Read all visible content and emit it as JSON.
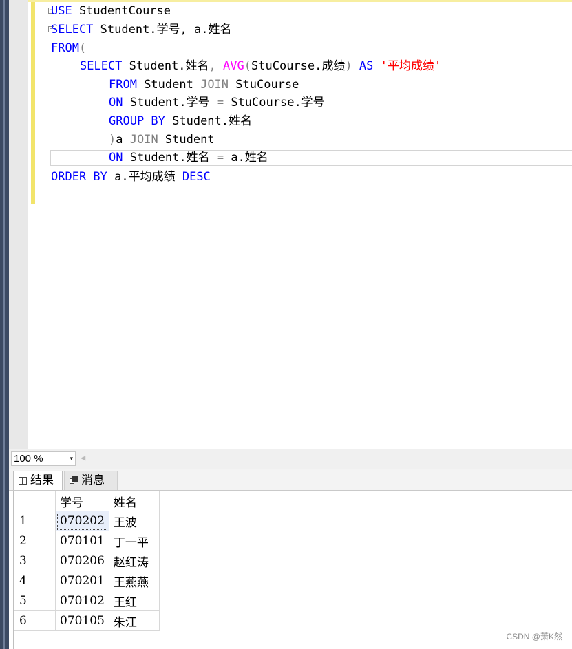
{
  "editor": {
    "lines": [
      [
        {
          "t": "USE",
          "c": "kw"
        },
        {
          "t": " StudentCourse",
          "c": "tx"
        }
      ],
      [
        {
          "t": "SELECT",
          "c": "kw"
        },
        {
          "t": " Student.学号, a.姓名",
          "c": "tx"
        }
      ],
      [
        {
          "t": "FROM",
          "c": "kw"
        },
        {
          "t": "(",
          "c": "gr"
        }
      ],
      [
        {
          "t": "SELECT",
          "c": "kw"
        },
        {
          "t": " Student.姓名",
          "c": "tx"
        },
        {
          "t": ",",
          "c": "gr"
        },
        {
          "t": " ",
          "c": "tx"
        },
        {
          "t": "AVG",
          "c": "fn"
        },
        {
          "t": "(",
          "c": "gr"
        },
        {
          "t": "StuCourse.成绩",
          "c": "tx"
        },
        {
          "t": ")",
          "c": "gr"
        },
        {
          "t": " AS",
          "c": "kw"
        },
        {
          "t": " '平均成绩'",
          "c": "str"
        }
      ],
      [
        {
          "t": "FROM",
          "c": "kw"
        },
        {
          "t": " Student ",
          "c": "tx"
        },
        {
          "t": "JOIN",
          "c": "gr"
        },
        {
          "t": " StuCourse",
          "c": "tx"
        }
      ],
      [
        {
          "t": "ON",
          "c": "kw"
        },
        {
          "t": " Student.学号 ",
          "c": "tx"
        },
        {
          "t": "=",
          "c": "gr"
        },
        {
          "t": " StuCourse.学号",
          "c": "tx"
        }
      ],
      [
        {
          "t": "GROUP BY",
          "c": "kw"
        },
        {
          "t": " Student.姓名",
          "c": "tx"
        }
      ],
      [
        {
          "t": ")",
          "c": "gr"
        },
        {
          "t": "a ",
          "c": "tx"
        },
        {
          "t": "JOIN",
          "c": "gr"
        },
        {
          "t": " Student",
          "c": "tx"
        }
      ],
      [
        {
          "t": "ON",
          "c": "kw"
        },
        {
          "t": " Student.姓名 ",
          "c": "tx"
        },
        {
          "t": "=",
          "c": "gr"
        },
        {
          "t": " a.姓名",
          "c": "tx"
        }
      ],
      [
        {
          "t": "ORDER BY",
          "c": "kw"
        },
        {
          "t": " a.平均成绩 ",
          "c": "tx"
        },
        {
          "t": "DESC",
          "c": "kw"
        }
      ]
    ]
  },
  "zoom": {
    "value": "100 %",
    "arrow": "▾"
  },
  "tabs": {
    "results": "结果",
    "messages": "消息"
  },
  "grid": {
    "columns": [
      "学号",
      "姓名"
    ],
    "rows": [
      {
        "n": "1",
        "id": "070202",
        "name": "王波"
      },
      {
        "n": "2",
        "id": "070101",
        "name": "丁一平"
      },
      {
        "n": "3",
        "id": "070206",
        "name": "赵红涛"
      },
      {
        "n": "4",
        "id": "070201",
        "name": "王燕燕"
      },
      {
        "n": "5",
        "id": "070102",
        "name": "王红"
      },
      {
        "n": "6",
        "id": "070105",
        "name": "朱江"
      }
    ]
  },
  "watermark": "CSDN @萧K然"
}
